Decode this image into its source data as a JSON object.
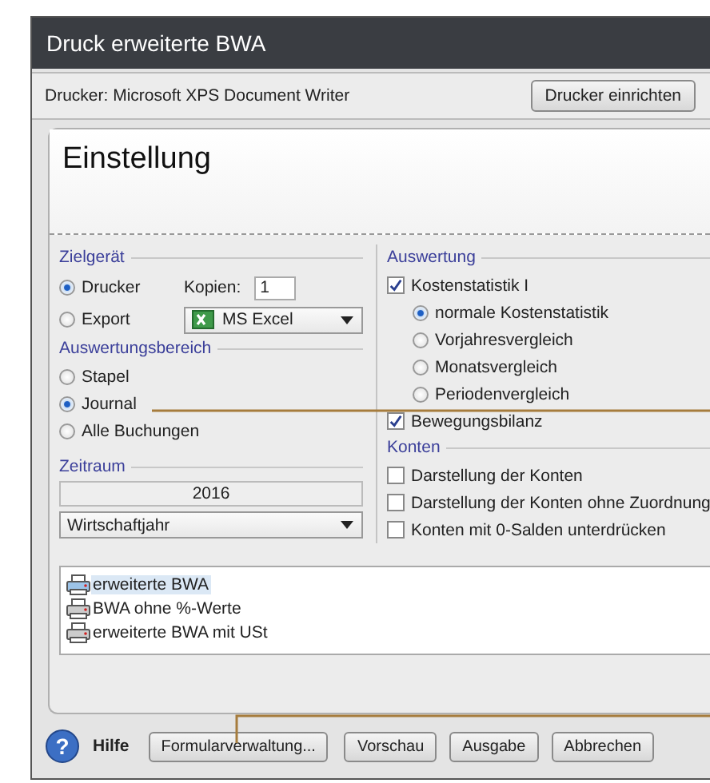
{
  "window": {
    "title": "Druck erweiterte BWA"
  },
  "printer_bar": {
    "label": "Drucker: Microsoft XPS Document Writer",
    "button": "Drucker einrichten"
  },
  "header": {
    "title": "Einstellung"
  },
  "target": {
    "legend": "Zielgerät",
    "options": [
      {
        "label": "Drucker",
        "selected": true
      },
      {
        "label": "Export",
        "selected": false
      }
    ],
    "copies_label": "Kopien:",
    "copies_value": "1",
    "export_format": "MS Excel"
  },
  "scope": {
    "legend": "Auswertungsbereich",
    "options": [
      {
        "label": "Stapel",
        "selected": false
      },
      {
        "label": "Journal",
        "selected": true
      },
      {
        "label": "Alle Buchungen",
        "selected": false
      }
    ]
  },
  "period": {
    "legend": "Zeitraum",
    "year": "2016",
    "type": "Wirtschaftjahr"
  },
  "evaluation": {
    "legend": "Auswertung",
    "items": [
      {
        "label": "Kostenstatistik I",
        "checked": true,
        "options": [
          {
            "label": "normale Kostenstatistik",
            "selected": true
          },
          {
            "label": "Vorjahresvergleich",
            "selected": false
          },
          {
            "label": "Monatsvergleich",
            "selected": false
          },
          {
            "label": "Periodenvergleich",
            "selected": false
          }
        ]
      },
      {
        "label": "Bewegungsbilanz",
        "checked": true
      }
    ]
  },
  "accounts": {
    "legend": "Konten",
    "items": [
      {
        "label": "Darstellung der Konten",
        "checked": false
      },
      {
        "label": "Darstellung der Konten ohne Zuordnung",
        "checked": false
      },
      {
        "label": "Konten mit 0-Salden unterdrücken",
        "checked": false
      }
    ]
  },
  "forms": [
    {
      "label": "erweiterte BWA",
      "selected": true
    },
    {
      "label": "BWA ohne %-Werte",
      "selected": false
    },
    {
      "label": "erweiterte BWA mit USt",
      "selected": false
    }
  ],
  "footer": {
    "help_icon": "?",
    "help": "Hilfe",
    "buttons": [
      "Formularverwaltung...",
      "Vorschau",
      "Ausgabe",
      "Abbrechen"
    ]
  }
}
